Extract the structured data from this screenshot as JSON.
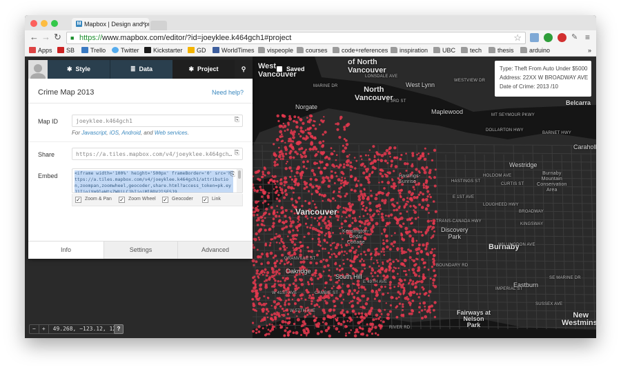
{
  "browser": {
    "tab_title": "Mapbox | Design and publi",
    "tab_close": "×",
    "url_scheme": "https://",
    "url_rest": "www.mapbox.com/editor/?id=joeyklee.k464gch1#project",
    "bookmarks": [
      "Apps",
      "SB",
      "Trello",
      "Twitter",
      "Kickstarter",
      "GD",
      "WorldTimes",
      "vispeople",
      "courses",
      "code+references",
      "inspiration",
      "UBC",
      "tech",
      "thesis",
      "arduino"
    ],
    "more": "»"
  },
  "editor": {
    "nav": {
      "style": "Style",
      "data": "Data",
      "project": "Project"
    },
    "saved": "Saved",
    "project_title": "Crime Map 2013",
    "help_link": "Need help?",
    "map_id_label": "Map ID",
    "map_id_value": "joeyklee.k464gch1",
    "for_prefix": "For ",
    "for_js": "Javascript",
    "for_ios": "iOS",
    "for_android": "Android",
    "for_and": ", and ",
    "for_web": "Web services",
    "for_end": ".",
    "share_label": "Share",
    "share_value": "https://a.tiles.mapbox.com/v4/joeyklee.k464gch…",
    "embed_label": "Embed",
    "embed_code": "<iframe width='100%' height='500px' frameBorder='0' src='https://a.tiles.mapbox.com/v4/joeyklee.k464gch1/attribution,zoompan,zoomwheel,geocoder,share.html?access_token=pk.eyJ1IjoiYm9leWtsZWUiLCJhIjoiMlBDV2lSESJ9",
    "checks": [
      {
        "label": "Zoom & Pan",
        "checked": true
      },
      {
        "label": "Zoom Wheel",
        "checked": true
      },
      {
        "label": "Geocoder",
        "checked": true
      },
      {
        "label": "Link",
        "checked": true
      }
    ],
    "tabs": {
      "info": "Info",
      "settings": "Settings",
      "advanced": "Advanced"
    }
  },
  "tooltip": {
    "line1": "Type: Theft From Auto Under $5000",
    "line2": "Address: 22XX W BROADWAY AVE",
    "line3": "Date of Crime: 2013 /10"
  },
  "map_controls": {
    "minus": "−",
    "plus": "+",
    "coords": "49.268, −123.12, 12",
    "help": "?"
  },
  "map_labels": {
    "west_vancouver": "West\nVancouver",
    "north_of_vancouver": "of North\nVancouver",
    "north_vancouver": "North\nVancouver",
    "west_lynn": "West Lynn",
    "norgate": "Norgate",
    "maplewood": "Maplewood",
    "belcarra": "Belcarra",
    "caraholly": "Caraholly",
    "westridge": "Westridge",
    "burnaby_mountain": "Burnaby\nMountain\nConservation\nArea",
    "hastings_sunrise": "Hastings-\nSunrise",
    "vancouver": "Vancouver",
    "discovery_park": "Discovery\nPark",
    "burnaby": "Burnaby",
    "kensington_cedar_cottage": "Kensington-\nCedar\nCottage",
    "oakridge": "Oakridge",
    "south_hill": "South Hill",
    "eastburn": "Eastburn",
    "fairways_at_nelson": "Fairways at\nNelson\nPark",
    "new_westminster": "New\nWestminst",
    "streets": [
      "MARINE DR",
      "LONSDALE AVE",
      "E 3RD ST",
      "WESTVIEW DR",
      "MT SEYMOUR PKWY",
      "DOLLARTON HWY",
      "BARNET HWY",
      "HASTINGS ST",
      "E 1ST AVE",
      "CURTIS ST",
      "KINGSWAY",
      "LOUGHEED HWY",
      "BROADWAY",
      "TRANS-CANADA HWY",
      "GRANVILLE ST",
      "CAMBIE ST",
      "W 41ST AVE",
      "E 49TH AVE",
      "IMPERIAL ST",
      "RIVER RD",
      "W 57TH AVE",
      "WILLINGDON AVE",
      "HOLDOM AVE",
      "BOUNDARY RD",
      "SE MARINE DR",
      "SUSSEX AVE"
    ]
  }
}
